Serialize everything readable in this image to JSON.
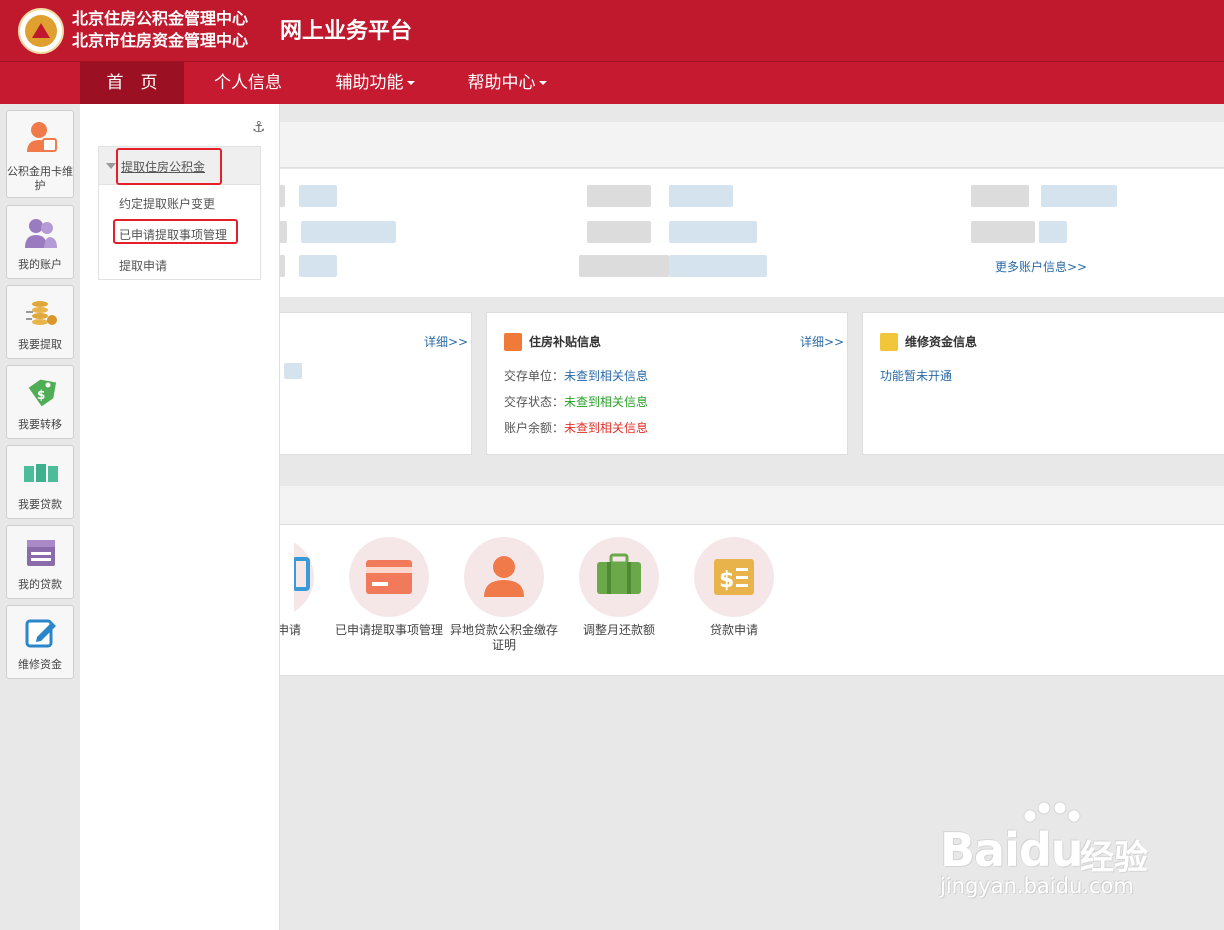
{
  "header": {
    "org_line1": "北京住房公积金管理中心",
    "org_line2": "北京市住房资金管理中心",
    "platform": "网上业务平台"
  },
  "nav": {
    "home": "首　页",
    "personal": "个人信息",
    "assist": "辅助功能",
    "help": "帮助中心"
  },
  "sidebar": [
    {
      "label": "公积金用卡维护",
      "icon": "person-card-icon"
    },
    {
      "label": "我的账户",
      "icon": "users-icon"
    },
    {
      "label": "我要提取",
      "icon": "coins-icon"
    },
    {
      "label": "我要转移",
      "icon": "tag-transfer-icon"
    },
    {
      "label": "我要贷款",
      "icon": "money-stack-icon"
    },
    {
      "label": "我的贷款",
      "icon": "store-icon"
    },
    {
      "label": "维修资金",
      "icon": "edit-icon"
    }
  ],
  "dropdown": {
    "header": "提取住房公积金",
    "items": [
      "约定提取账户变更",
      "已申请提取事项管理",
      "提取申请"
    ]
  },
  "account": {
    "more_link": "更多账户信息>>"
  },
  "cards": {
    "detail_link": "详细>>",
    "subsidy": {
      "title": "住房补贴信息",
      "rows": [
        {
          "label": "交存单位：",
          "value": "未查到相关信息"
        },
        {
          "label": "交存状态：",
          "value": "未查到相关信息"
        },
        {
          "label": "账户余额：",
          "value": "未查到相关信息"
        }
      ]
    },
    "repair": {
      "title": "维修资金信息",
      "text": "功能暂未开通"
    }
  },
  "services": [
    {
      "label": "申请"
    },
    {
      "label": "已申请提取事项管理"
    },
    {
      "label": "异地贷款公积金缴存证明"
    },
    {
      "label": "调整月还款额"
    },
    {
      "label": "贷款申请"
    }
  ],
  "watermark": {
    "brand": "Baidu",
    "cn": "经验",
    "url": "jingyan.baidu.com"
  },
  "colors": {
    "brand_red": "#c0192e",
    "link_blue": "#2b6aa8",
    "status_green": "#2aa02a",
    "status_red": "#e0302a"
  }
}
